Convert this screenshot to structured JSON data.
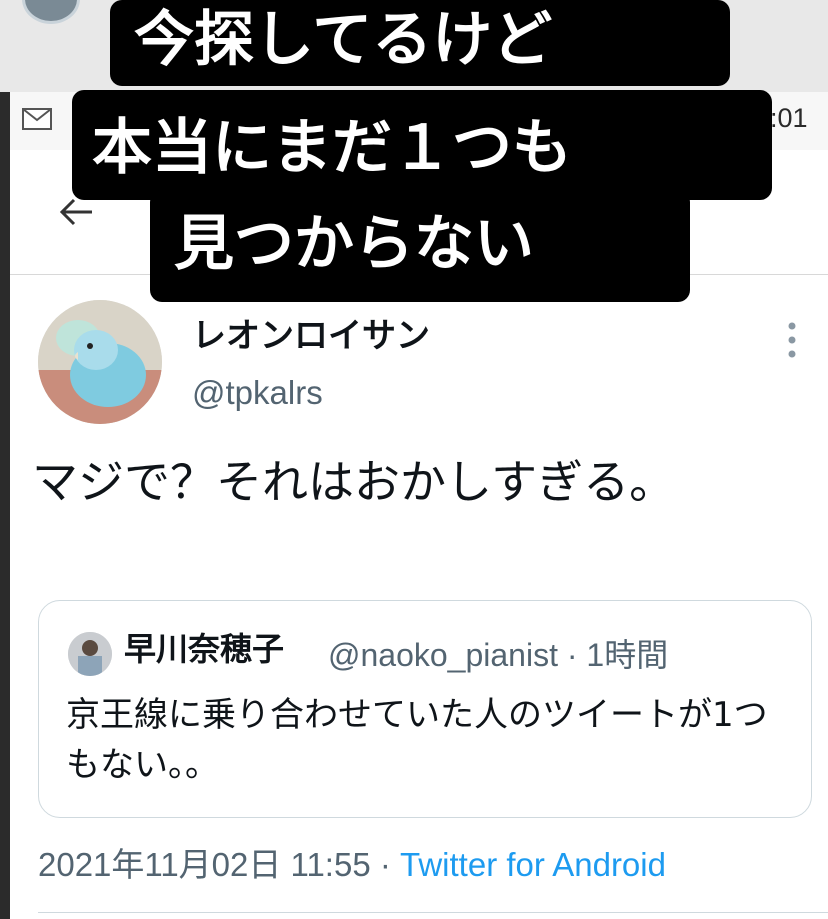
{
  "status_bar": {
    "time_partial": ":01"
  },
  "caption_overlay": {
    "line1": "今探してるけど",
    "line2": "本当にまだ１つも",
    "line3": "見つからない"
  },
  "tweet": {
    "display_name": "レオンロイサン",
    "handle": "@tpkalrs",
    "text": "マジで？それはおかしすぎる。",
    "timestamp": "2021年11月02日 11:55 · ",
    "source": "Twitter for Android"
  },
  "quoted_tweet": {
    "display_name": "早川奈穂子",
    "handle": "@naoko_pianist · 1時間",
    "text": "京王線に乗り合わせていた人のツイートが1つもない。。"
  },
  "icons": [
    "mail-icon",
    "back-arrow-icon",
    "more-vertical-icon",
    "avatar-parakeet",
    "avatar-small"
  ],
  "colors": {
    "link": "#1d9bf0",
    "secondary_text": "#536471",
    "primary_text": "#0f1419",
    "border": "#cfd9de"
  }
}
